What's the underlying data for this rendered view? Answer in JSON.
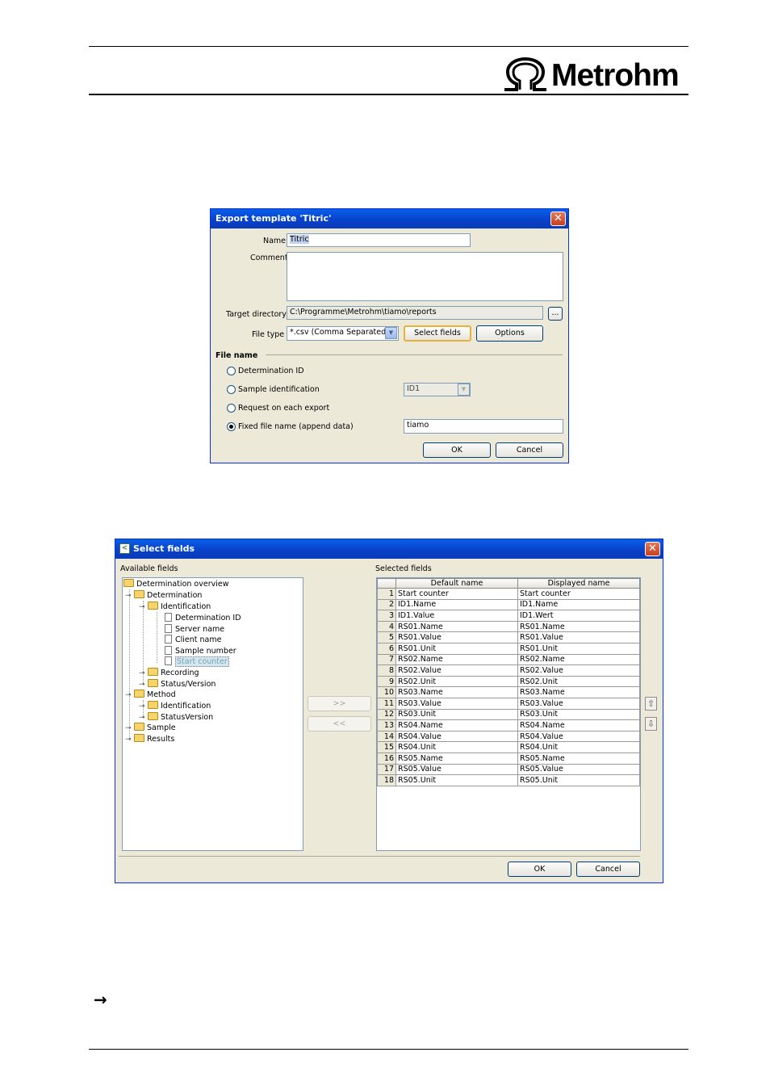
{
  "header": {
    "logo": "Metrohm"
  },
  "export_dialog": {
    "title": "Export template 'Titric'",
    "name_label": "Name",
    "name_value": "Titric",
    "comment_label": "Comment",
    "comment_value": "",
    "target_dir_label": "Target directory",
    "target_dir_value": "C:\\Programme\\Metrohm\\tiamo\\reports",
    "browse_label": "...",
    "file_type_label": "File type",
    "file_type_value": "*.csv (Comma Separated)",
    "select_fields_label": "Select fields",
    "options_label": "Options",
    "file_name_section": "File name",
    "radio_determination": "Determination ID",
    "radio_sample": "Sample identification",
    "sample_select_value": "ID1",
    "radio_request": "Request on each export",
    "radio_fixed": "Fixed file name (append data)",
    "fixed_value": "tiamo",
    "ok_label": "OK",
    "cancel_label": "Cancel"
  },
  "select_dialog": {
    "title": "Select fields",
    "available_label": "Available fields",
    "selected_label": "Selected fields",
    "tree": {
      "root": "Determination overview",
      "determination": "Determination",
      "identification": "Identification",
      "items": [
        "Determination ID",
        "Server name",
        "Client name",
        "Sample number",
        "Start counter"
      ],
      "recording": "Recording",
      "status_version": "Status/Version",
      "method": "Method",
      "method_identification": "Identification",
      "method_status": "StatusVersion",
      "sample": "Sample",
      "results": "Results"
    },
    "add_label": ">>",
    "remove_label": "<<",
    "columns": [
      "",
      "Default name",
      "Displayed name"
    ],
    "rows": [
      [
        "1",
        "Start counter",
        "Start counter"
      ],
      [
        "2",
        "ID1.Name",
        "ID1.Name"
      ],
      [
        "3",
        "ID1.Value",
        "ID1.Wert"
      ],
      [
        "4",
        "RS01.Name",
        "RS01.Name"
      ],
      [
        "5",
        "RS01.Value",
        "RS01.Value"
      ],
      [
        "6",
        "RS01.Unit",
        "RS01.Unit"
      ],
      [
        "7",
        "RS02.Name",
        "RS02.Name"
      ],
      [
        "8",
        "RS02.Value",
        "RS02.Value"
      ],
      [
        "9",
        "RS02.Unit",
        "RS02.Unit"
      ],
      [
        "10",
        "RS03.Name",
        "RS03.Name"
      ],
      [
        "11",
        "RS03.Value",
        "RS03.Value"
      ],
      [
        "12",
        "RS03.Unit",
        "RS03.Unit"
      ],
      [
        "13",
        "RS04.Name",
        "RS04.Name"
      ],
      [
        "14",
        "RS04.Value",
        "RS04.Value"
      ],
      [
        "15",
        "RS04.Unit",
        "RS04.Unit"
      ],
      [
        "16",
        "RS05.Name",
        "RS05.Name"
      ],
      [
        "17",
        "RS05.Value",
        "RS05.Value"
      ],
      [
        "18",
        "RS05.Unit",
        "RS05.Unit"
      ]
    ],
    "ok_label": "OK",
    "cancel_label": "Cancel"
  },
  "footer": {
    "arrow": "→"
  }
}
